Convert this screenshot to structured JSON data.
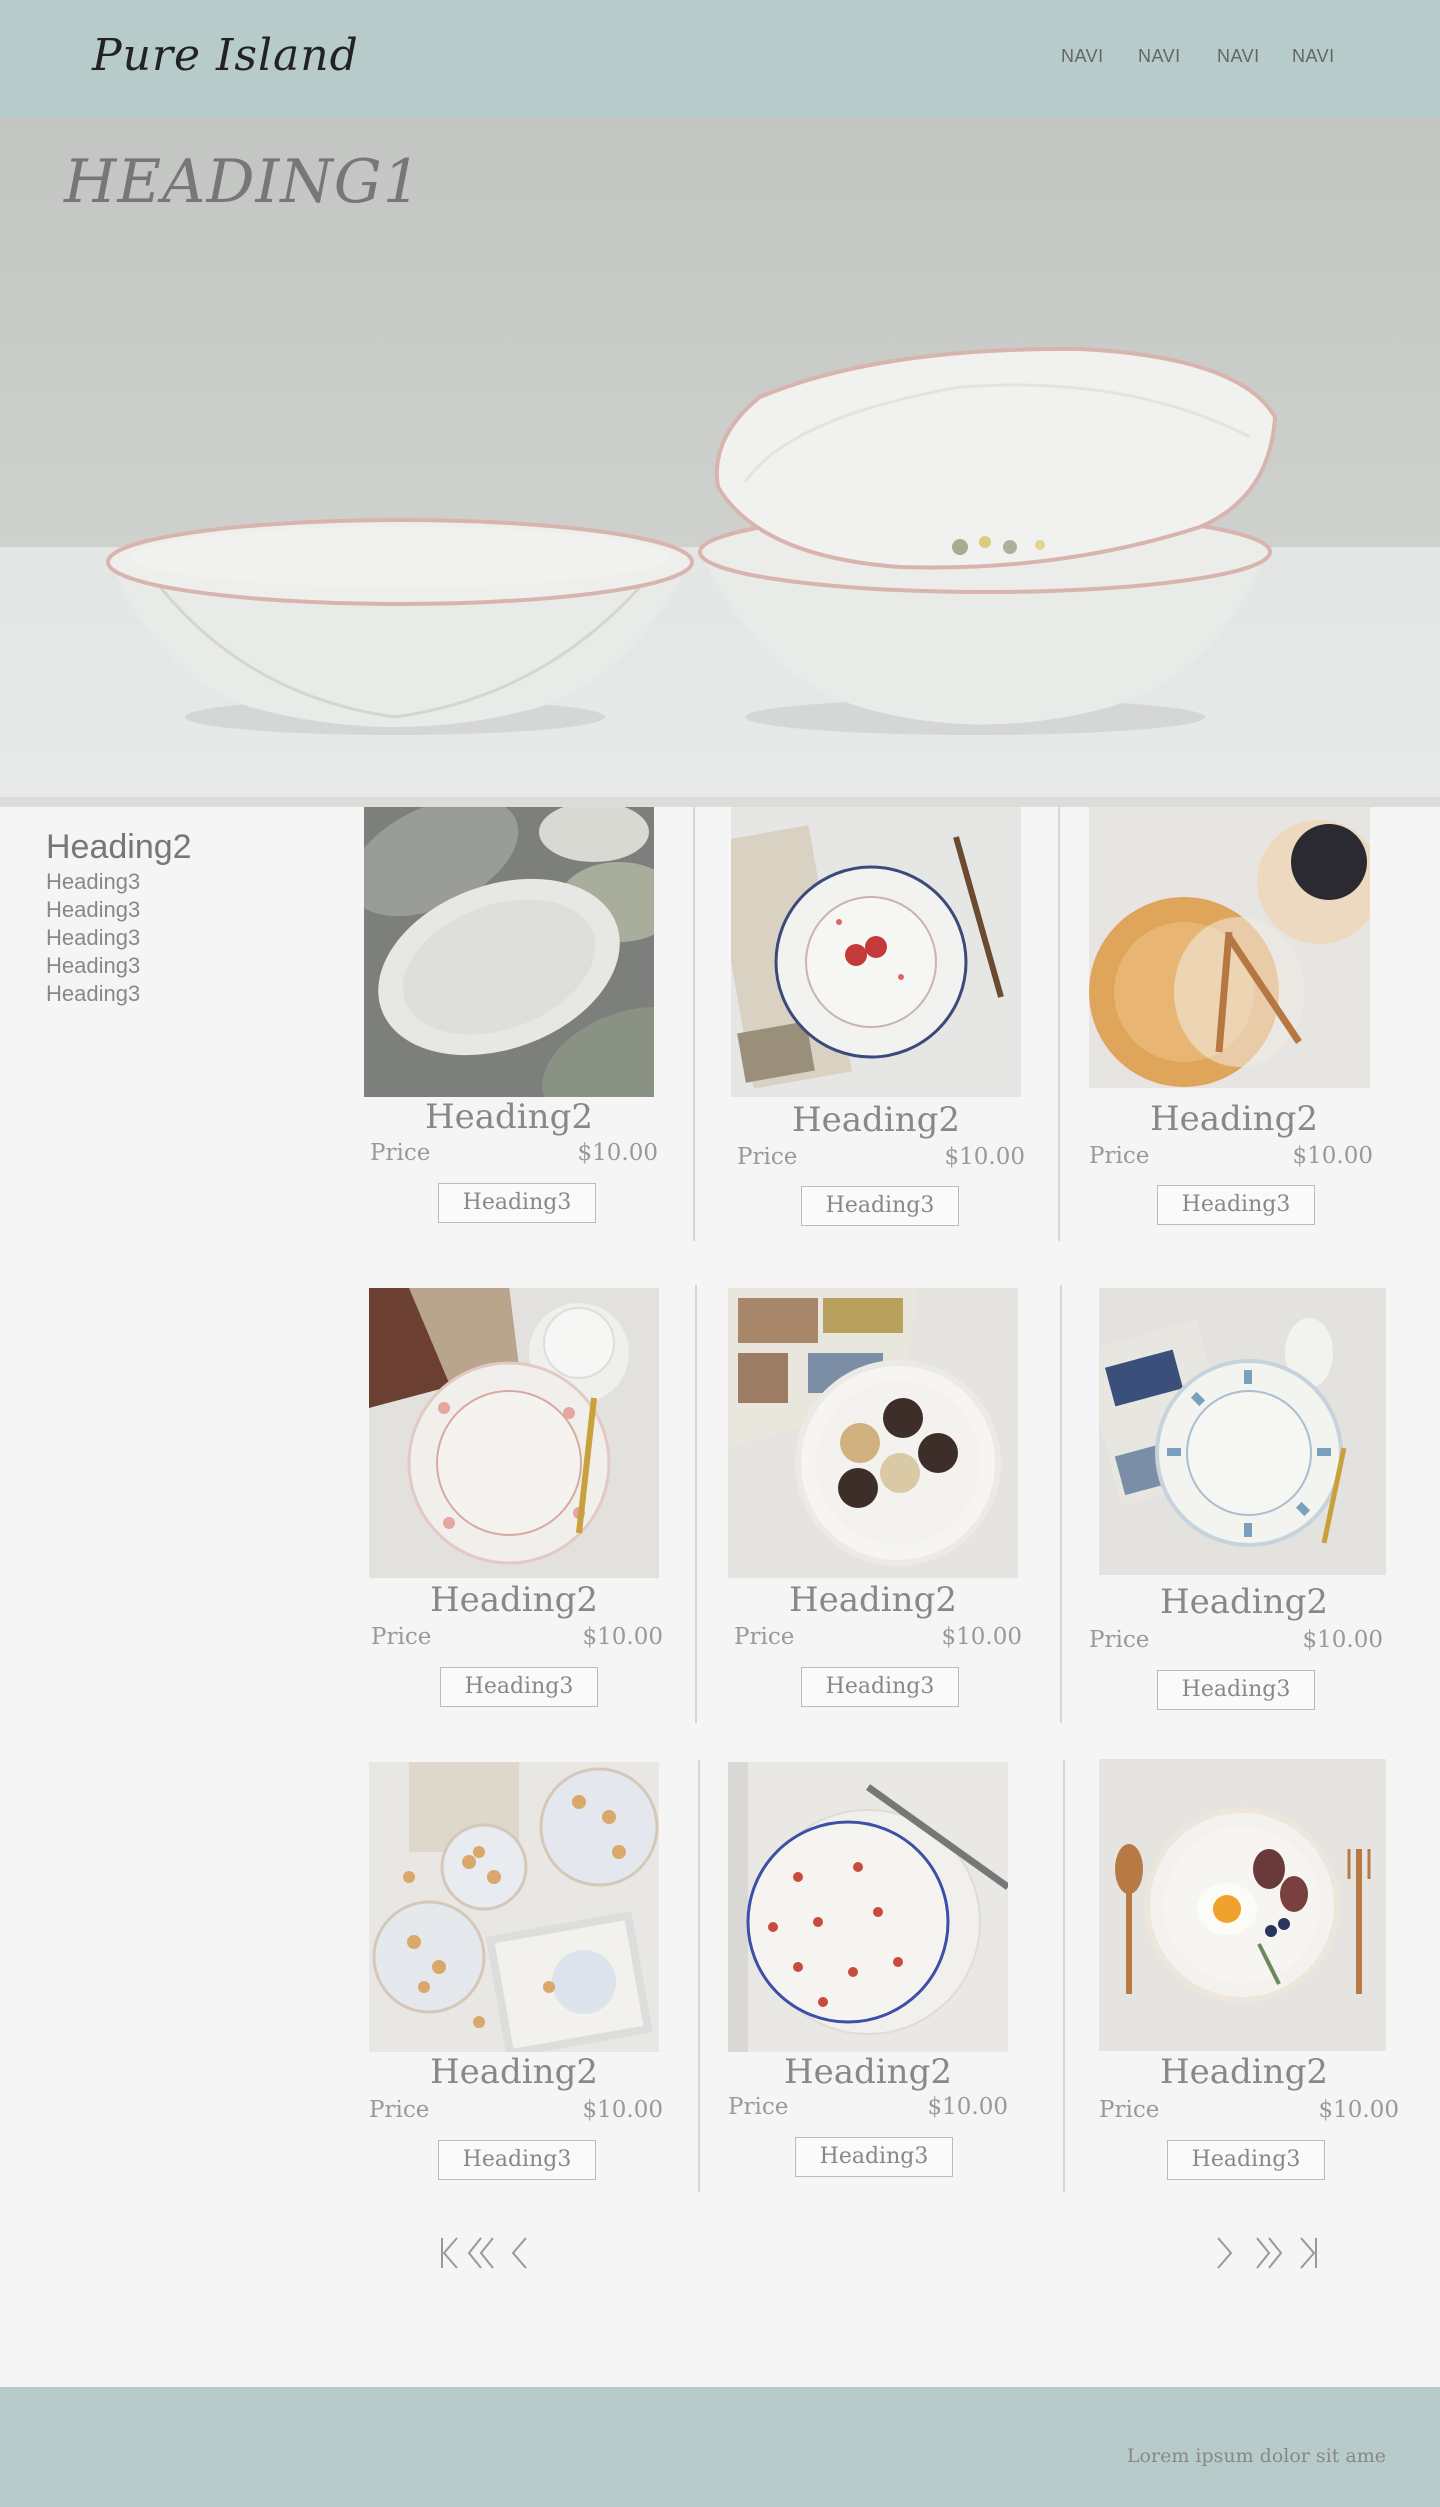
{
  "header": {
    "logo": "Pure Island",
    "nav": [
      "NAVI",
      "NAVI",
      "NAVI",
      "NAVI"
    ]
  },
  "hero": {
    "title": "HEADING1"
  },
  "sidebar": {
    "heading": "Heading2",
    "items": [
      "Heading3",
      "Heading3",
      "Heading3",
      "Heading3",
      "Heading3"
    ]
  },
  "products": [
    {
      "title": "Heading2",
      "price_label": "Price",
      "price": "$10.00",
      "button": "Heading3"
    },
    {
      "title": "Heading2",
      "price_label": "Price",
      "price": "$10.00",
      "button": "Heading3"
    },
    {
      "title": "Heading2",
      "price_label": "Price",
      "price": "$10.00",
      "button": "Heading3"
    },
    {
      "title": "Heading2",
      "price_label": "Price",
      "price": "$10.00",
      "button": "Heading3"
    },
    {
      "title": "Heading2",
      "price_label": "Price",
      "price": "$10.00",
      "button": "Heading3"
    },
    {
      "title": "Heading2",
      "price_label": "Price",
      "price": "$10.00",
      "button": "Heading3"
    },
    {
      "title": "Heading2",
      "price_label": "Price",
      "price": "$10.00",
      "button": "Heading3"
    },
    {
      "title": "Heading2",
      "price_label": "Price",
      "price": "$10.00",
      "button": "Heading3"
    },
    {
      "title": "Heading2",
      "price_label": "Price",
      "price": "$10.00",
      "button": "Heading3"
    }
  ],
  "pagination": {
    "icons": [
      "first-page-icon",
      "previous-block-icon",
      "previous-page-icon",
      "next-page-icon",
      "next-block-icon",
      "last-page-icon"
    ]
  },
  "footer": {
    "text": "Lorem ipsum dolor sit ame"
  },
  "colors": {
    "header_bg": "#b6cbca",
    "footer_bg": "#b6cbca",
    "page_bg": "#f5f5f5"
  }
}
